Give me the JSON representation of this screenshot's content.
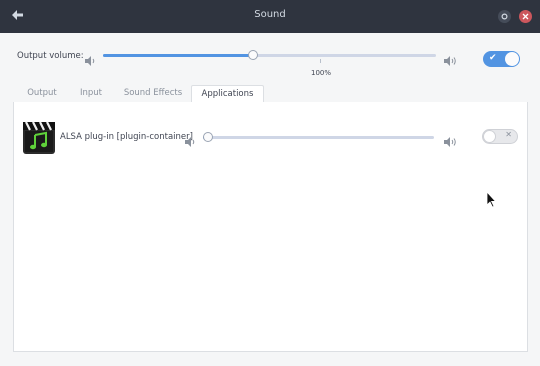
{
  "window": {
    "title": "Sound",
    "back_icon": "back-arrow-icon",
    "minimize_icon": "minimize-icon",
    "close_icon": "close-icon"
  },
  "output": {
    "label": "Output volume:",
    "volume_percent": 45,
    "tick_label": "100%",
    "mute_toggle_on": true,
    "low_icon": "speaker-low-icon",
    "high_icon": "speaker-high-icon"
  },
  "tabs": [
    {
      "label": "Output",
      "active": false
    },
    {
      "label": "Input",
      "active": false
    },
    {
      "label": "Sound Effects",
      "active": false
    },
    {
      "label": "Applications",
      "active": true
    }
  ],
  "applications": [
    {
      "name": "ALSA plug-in [plugin-container]",
      "icon": "media-player-icon",
      "volume_percent": 0,
      "enabled": false
    }
  ],
  "colors": {
    "titlebar": "#2f343f",
    "accent": "#5294e2",
    "close": "#cc575d"
  }
}
